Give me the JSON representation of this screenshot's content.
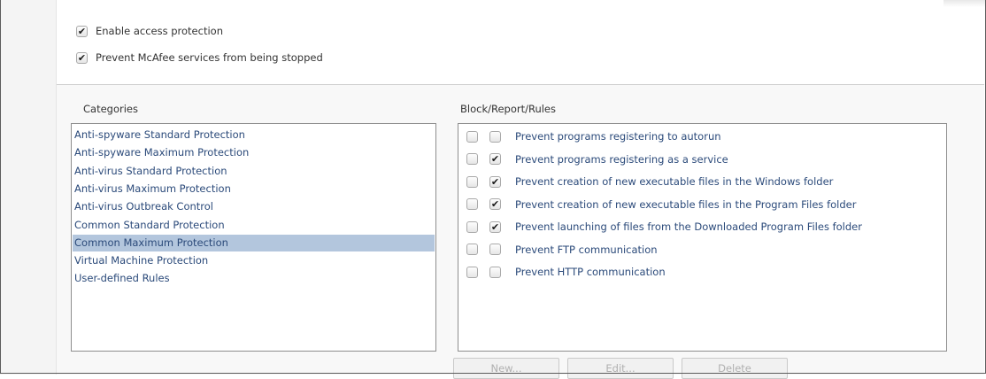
{
  "options": {
    "enable_access_protection": {
      "label": "Enable access protection",
      "checked": true
    },
    "prevent_services_stopped": {
      "label": "Prevent McAfee services from being stopped",
      "checked": true
    }
  },
  "categories": {
    "heading": "Categories",
    "items": [
      "Anti-spyware Standard Protection",
      "Anti-spyware Maximum Protection",
      "Anti-virus Standard Protection",
      "Anti-virus Maximum Protection",
      "Anti-virus Outbreak Control",
      "Common Standard Protection",
      "Common Maximum Protection",
      "Virtual Machine Protection",
      "User-defined Rules"
    ],
    "selected": "Common Maximum Protection"
  },
  "rules": {
    "heading": "Block/Report/Rules",
    "items": [
      {
        "block": false,
        "report": false,
        "label": "Prevent programs registering to autorun"
      },
      {
        "block": false,
        "report": true,
        "label": "Prevent programs registering as a service"
      },
      {
        "block": false,
        "report": true,
        "label": "Prevent creation of new executable files in the Windows folder"
      },
      {
        "block": false,
        "report": true,
        "label": "Prevent creation of new executable files in the Program Files folder"
      },
      {
        "block": false,
        "report": true,
        "label": "Prevent launching of files from the Downloaded Program Files folder"
      },
      {
        "block": false,
        "report": false,
        "label": "Prevent FTP communication"
      },
      {
        "block": false,
        "report": false,
        "label": "Prevent HTTP communication"
      }
    ]
  },
  "buttons": {
    "new": "New...",
    "edit": "Edit...",
    "delete": "Delete"
  },
  "colors": {
    "selection": "#b3c6dd",
    "link_text": "#2b4a7a",
    "panel_background": "#f8f8f8"
  }
}
